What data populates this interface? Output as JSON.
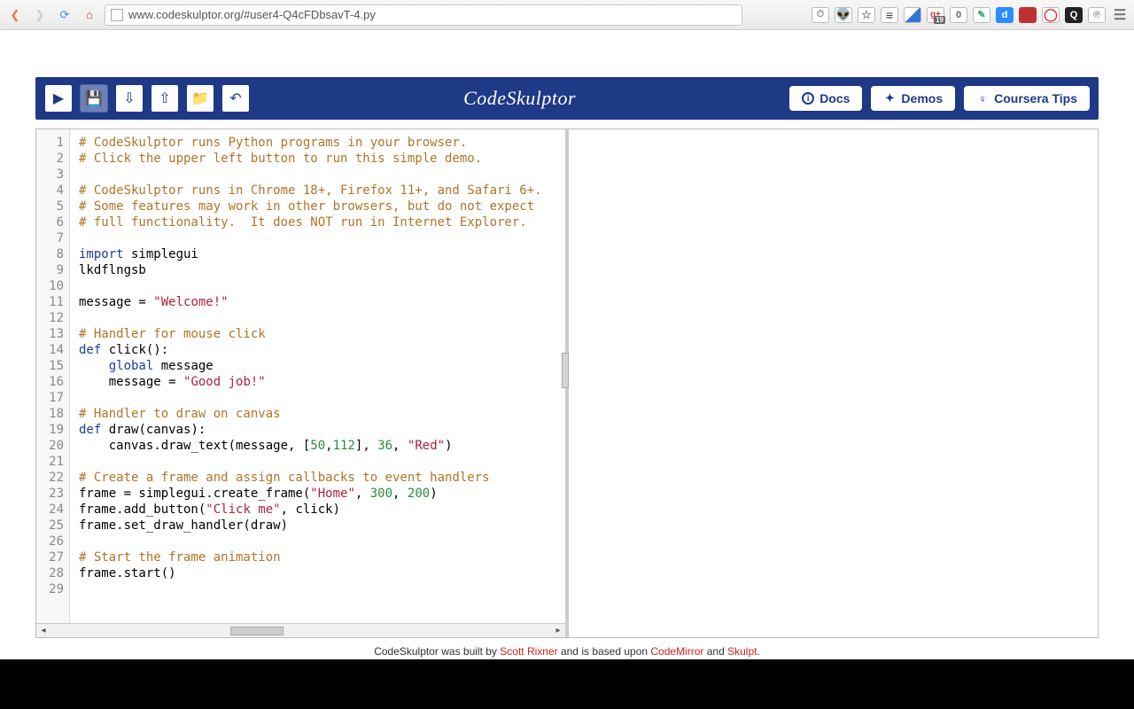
{
  "browser": {
    "url": "www.codeskulptor.org/#user4-Q4cFDbsavT-4.py",
    "zero_badge": "0",
    "gplus_badge": "19"
  },
  "header": {
    "brand": "CodeSkulptor",
    "buttons": {
      "docs": "Docs",
      "demos": "Demos",
      "coursera": "Coursera Tips"
    }
  },
  "code": {
    "lines": [
      {
        "t": "comment",
        "text": "# CodeSkulptor runs Python programs in your browser."
      },
      {
        "t": "comment",
        "text": "# Click the upper left button to run this simple demo."
      },
      {
        "t": "blank",
        "text": ""
      },
      {
        "t": "comment",
        "text": "# CodeSkulptor runs in Chrome 18+, Firefox 11+, and Safari 6+."
      },
      {
        "t": "comment",
        "text": "# Some features may work in other browsers, but do not expect"
      },
      {
        "t": "comment",
        "text": "# full functionality.  It does NOT run in Internet Explorer."
      },
      {
        "t": "blank",
        "text": ""
      },
      {
        "t": "import",
        "kw": "import",
        "rest": " simplegui"
      },
      {
        "t": "plain",
        "text": "lkdflngsb"
      },
      {
        "t": "blank",
        "text": ""
      },
      {
        "t": "assign",
        "lhs": "message = ",
        "str": "\"Welcome!\""
      },
      {
        "t": "blank",
        "text": ""
      },
      {
        "t": "comment",
        "text": "# Handler for mouse click"
      },
      {
        "t": "def",
        "kw": "def",
        "name": " click():"
      },
      {
        "t": "globalline",
        "indent": "    ",
        "kw": "global",
        "rest": " message"
      },
      {
        "t": "assign",
        "indent": "    ",
        "lhs": "message = ",
        "str": "\"Good job!\""
      },
      {
        "t": "blank",
        "text": ""
      },
      {
        "t": "comment",
        "text": "# Handler to draw on canvas"
      },
      {
        "t": "def",
        "kw": "def",
        "name": " draw(canvas):"
      },
      {
        "t": "drawtext",
        "indent": "    ",
        "p1": "canvas.draw_text(message, [",
        "n1": "50",
        "c1": ",",
        "n2": "112",
        "p2": "], ",
        "n3": "36",
        "p3": ", ",
        "str": "\"Red\"",
        "p4": ")"
      },
      {
        "t": "blank",
        "text": ""
      },
      {
        "t": "comment",
        "text": "# Create a frame and assign callbacks to event handlers"
      },
      {
        "t": "createframe",
        "p1": "frame = simplegui.create_frame(",
        "s1": "\"Home\"",
        "c1": ", ",
        "n1": "300",
        "c2": ", ",
        "n2": "200",
        "p2": ")"
      },
      {
        "t": "addbutton",
        "p1": "frame.add_button(",
        "s1": "\"Click me\"",
        "p2": ", click)"
      },
      {
        "t": "plain",
        "text": "frame.set_draw_handler(draw)"
      },
      {
        "t": "blank",
        "text": ""
      },
      {
        "t": "comment",
        "text": "# Start the frame animation"
      },
      {
        "t": "plain",
        "text": "frame.start()"
      },
      {
        "t": "blank",
        "text": ""
      }
    ]
  },
  "footer": {
    "pre": "CodeSkulptor was built by ",
    "a1": "Scott Rixner",
    "mid": " and is based upon ",
    "a2": "CodeMirror",
    "and": " and ",
    "a3": "Skulpt",
    "post": "."
  }
}
